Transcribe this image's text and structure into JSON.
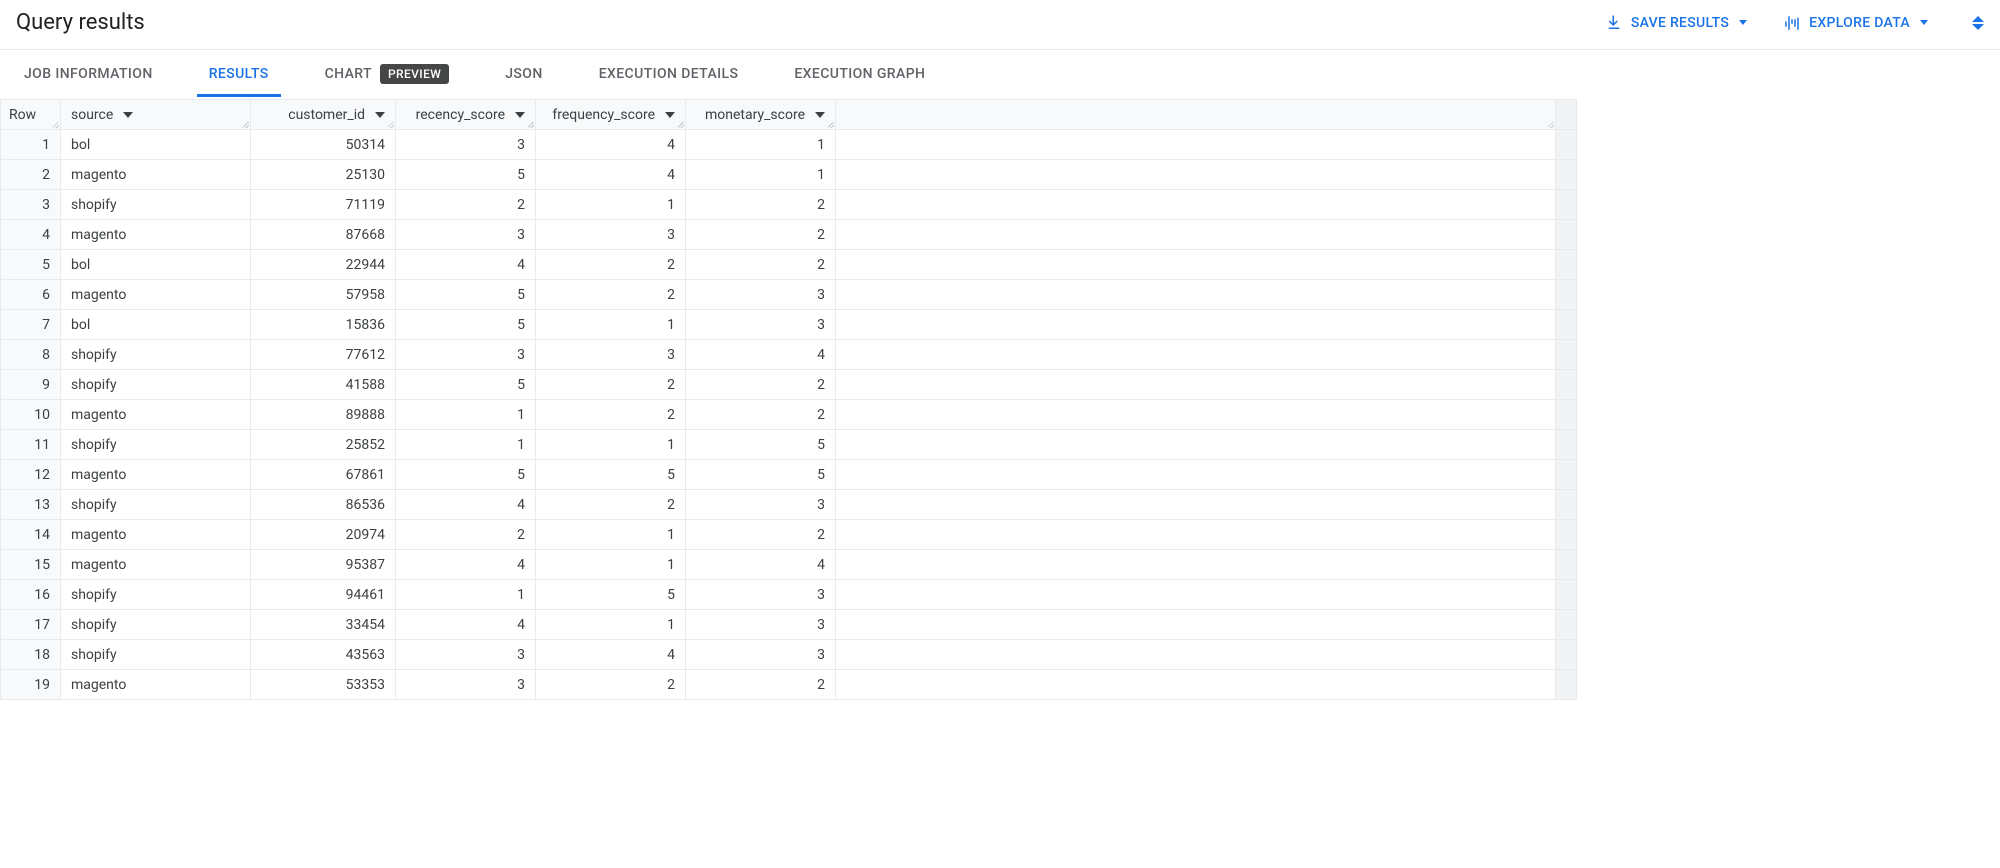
{
  "header": {
    "title": "Query results",
    "save_results_label": "SAVE RESULTS",
    "explore_data_label": "EXPLORE DATA"
  },
  "tabs": {
    "job_information": "JOB INFORMATION",
    "results": "RESULTS",
    "chart": "CHART",
    "chart_badge": "PREVIEW",
    "json": "JSON",
    "execution_details": "EXECUTION DETAILS",
    "execution_graph": "EXECUTION GRAPH",
    "active": "results"
  },
  "table": {
    "columns": {
      "row": "Row",
      "source": "source",
      "customer_id": "customer_id",
      "recency_score": "recency_score",
      "frequency_score": "frequency_score",
      "monetary_score": "monetary_score"
    },
    "rows": [
      {
        "row": 1,
        "source": "bol",
        "customer_id": 50314,
        "recency_score": 3,
        "frequency_score": 4,
        "monetary_score": 1
      },
      {
        "row": 2,
        "source": "magento",
        "customer_id": 25130,
        "recency_score": 5,
        "frequency_score": 4,
        "monetary_score": 1
      },
      {
        "row": 3,
        "source": "shopify",
        "customer_id": 71119,
        "recency_score": 2,
        "frequency_score": 1,
        "monetary_score": 2
      },
      {
        "row": 4,
        "source": "magento",
        "customer_id": 87668,
        "recency_score": 3,
        "frequency_score": 3,
        "monetary_score": 2
      },
      {
        "row": 5,
        "source": "bol",
        "customer_id": 22944,
        "recency_score": 4,
        "frequency_score": 2,
        "monetary_score": 2
      },
      {
        "row": 6,
        "source": "magento",
        "customer_id": 57958,
        "recency_score": 5,
        "frequency_score": 2,
        "monetary_score": 3
      },
      {
        "row": 7,
        "source": "bol",
        "customer_id": 15836,
        "recency_score": 5,
        "frequency_score": 1,
        "monetary_score": 3
      },
      {
        "row": 8,
        "source": "shopify",
        "customer_id": 77612,
        "recency_score": 3,
        "frequency_score": 3,
        "monetary_score": 4
      },
      {
        "row": 9,
        "source": "shopify",
        "customer_id": 41588,
        "recency_score": 5,
        "frequency_score": 2,
        "monetary_score": 2
      },
      {
        "row": 10,
        "source": "magento",
        "customer_id": 89888,
        "recency_score": 1,
        "frequency_score": 2,
        "monetary_score": 2
      },
      {
        "row": 11,
        "source": "shopify",
        "customer_id": 25852,
        "recency_score": 1,
        "frequency_score": 1,
        "monetary_score": 5
      },
      {
        "row": 12,
        "source": "magento",
        "customer_id": 67861,
        "recency_score": 5,
        "frequency_score": 5,
        "monetary_score": 5
      },
      {
        "row": 13,
        "source": "shopify",
        "customer_id": 86536,
        "recency_score": 4,
        "frequency_score": 2,
        "monetary_score": 3
      },
      {
        "row": 14,
        "source": "magento",
        "customer_id": 20974,
        "recency_score": 2,
        "frequency_score": 1,
        "monetary_score": 2
      },
      {
        "row": 15,
        "source": "magento",
        "customer_id": 95387,
        "recency_score": 4,
        "frequency_score": 1,
        "monetary_score": 4
      },
      {
        "row": 16,
        "source": "shopify",
        "customer_id": 94461,
        "recency_score": 1,
        "frequency_score": 5,
        "monetary_score": 3
      },
      {
        "row": 17,
        "source": "shopify",
        "customer_id": 33454,
        "recency_score": 4,
        "frequency_score": 1,
        "monetary_score": 3
      },
      {
        "row": 18,
        "source": "shopify",
        "customer_id": 43563,
        "recency_score": 3,
        "frequency_score": 4,
        "monetary_score": 3
      },
      {
        "row": 19,
        "source": "magento",
        "customer_id": 53353,
        "recency_score": 3,
        "frequency_score": 2,
        "monetary_score": 2
      }
    ]
  }
}
